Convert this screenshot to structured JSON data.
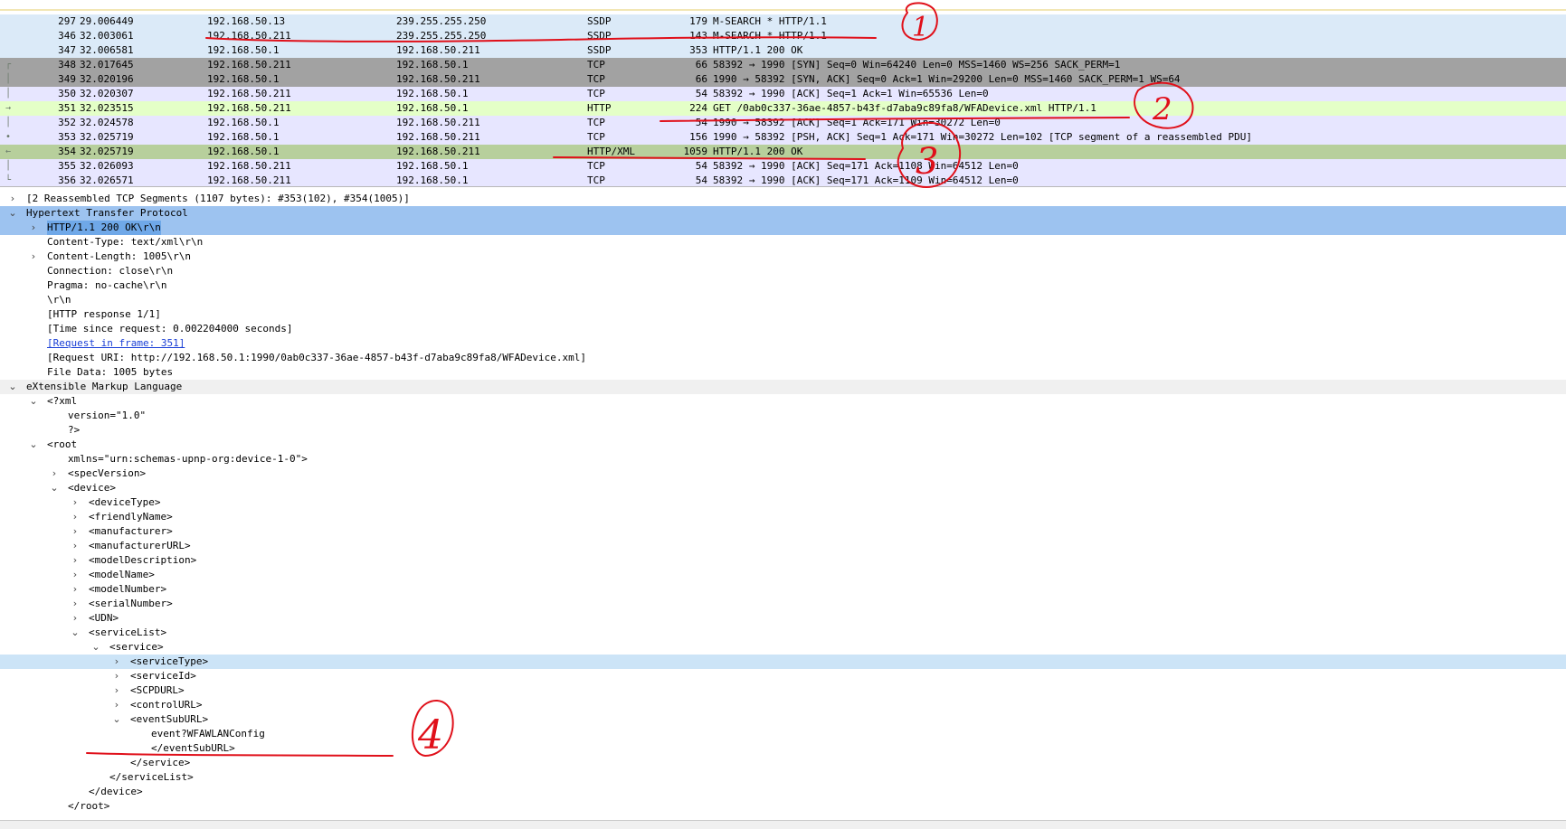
{
  "packet_list": {
    "rows": [
      {
        "no": "297",
        "time": "29.006449",
        "source": "192.168.50.13",
        "destination": "239.255.255.250",
        "protocol": "SSDP",
        "length": "179",
        "info": "M-SEARCH * HTTP/1.1",
        "bg": "#dbeaf8",
        "mark": ""
      },
      {
        "no": "346",
        "time": "32.003061",
        "source": "192.168.50.211",
        "destination": "239.255.255.250",
        "protocol": "SSDP",
        "length": "143",
        "info": "M-SEARCH * HTTP/1.1",
        "bg": "#dbeaf8",
        "mark": ""
      },
      {
        "no": "347",
        "time": "32.006581",
        "source": "192.168.50.1",
        "destination": "192.168.50.211",
        "protocol": "SSDP",
        "length": "353",
        "info": "HTTP/1.1 200 OK",
        "bg": "#dbeaf8",
        "mark": ""
      },
      {
        "no": "348",
        "time": "32.017645",
        "source": "192.168.50.211",
        "destination": "192.168.50.1",
        "protocol": "TCP",
        "length": "66",
        "info": "58392 → 1990 [SYN] Seq=0 Win=64240 Len=0 MSS=1460 WS=256 SACK_PERM=1",
        "bg": "#a2a2a2",
        "mark": "┌"
      },
      {
        "no": "349",
        "time": "32.020196",
        "source": "192.168.50.1",
        "destination": "192.168.50.211",
        "protocol": "TCP",
        "length": "66",
        "info": "1990 → 58392 [SYN, ACK] Seq=0 Ack=1 Win=29200 Len=0 MSS=1460 SACK_PERM=1 WS=64",
        "bg": "#a2a2a2",
        "mark": "│"
      },
      {
        "no": "350",
        "time": "32.020307",
        "source": "192.168.50.211",
        "destination": "192.168.50.1",
        "protocol": "TCP",
        "length": "54",
        "info": "58392 → 1990 [ACK] Seq=1 Ack=1 Win=65536 Len=0",
        "bg": "#e7e6ff",
        "mark": "│"
      },
      {
        "no": "351",
        "time": "32.023515",
        "source": "192.168.50.211",
        "destination": "192.168.50.1",
        "protocol": "HTTP",
        "length": "224",
        "info": "GET /0ab0c337-36ae-4857-b43f-d7aba9c89fa8/WFADevice.xml HTTP/1.1",
        "bg": "#e4ffc7",
        "mark": "→"
      },
      {
        "no": "352",
        "time": "32.024578",
        "source": "192.168.50.1",
        "destination": "192.168.50.211",
        "protocol": "TCP",
        "length": "54",
        "info": "1990 → 58392 [ACK] Seq=1 Ack=171 Win=30272 Len=0",
        "bg": "#e7e6ff",
        "mark": "│"
      },
      {
        "no": "353",
        "time": "32.025719",
        "source": "192.168.50.1",
        "destination": "192.168.50.211",
        "protocol": "TCP",
        "length": "156",
        "info": "1990 → 58392 [PSH, ACK] Seq=1 Ack=171 Win=30272 Len=102 [TCP segment of a reassembled PDU]",
        "bg": "#e7e6ff",
        "mark": "•"
      },
      {
        "no": "354",
        "time": "32.025719",
        "source": "192.168.50.1",
        "destination": "192.168.50.211",
        "protocol": "HTTP/XML",
        "length": "1059",
        "info": "HTTP/1.1 200 OK",
        "bg": "#b7cf9c",
        "mark": "←"
      },
      {
        "no": "355",
        "time": "32.026093",
        "source": "192.168.50.211",
        "destination": "192.168.50.1",
        "protocol": "TCP",
        "length": "54",
        "info": "58392 → 1990 [ACK] Seq=171 Ack=1108 Win=64512 Len=0",
        "bg": "#e7e6ff",
        "mark": "│"
      },
      {
        "no": "356",
        "time": "32.026571",
        "source": "192.168.50.211",
        "destination": "192.168.50.1",
        "protocol": "TCP",
        "length": "54",
        "info": "58392 → 1990 [ACK] Seq=171 Ack=1109 Win=64512 Len=0",
        "bg": "#e7e6ff",
        "mark": "└"
      }
    ]
  },
  "details": {
    "lines": [
      {
        "arrow": "›",
        "indent": 0,
        "text": "[2 Reassembled TCP Segments (1107 bytes): #353(102), #354(1005)]",
        "style": ""
      },
      {
        "arrow": "⌄",
        "indent": 0,
        "text": "Hypertext Transfer Protocol",
        "style": "hdr"
      },
      {
        "arrow": "›",
        "indent": 1,
        "text": "HTTP/1.1 200 OK\\r\\n",
        "style": "inner"
      },
      {
        "arrow": "",
        "indent": 1,
        "text": "Content-Type: text/xml\\r\\n",
        "style": ""
      },
      {
        "arrow": "›",
        "indent": 1,
        "text": "Content-Length: 1005\\r\\n",
        "style": ""
      },
      {
        "arrow": "",
        "indent": 1,
        "text": "Connection: close\\r\\n",
        "style": ""
      },
      {
        "arrow": "",
        "indent": 1,
        "text": "Pragma: no-cache\\r\\n",
        "style": ""
      },
      {
        "arrow": "",
        "indent": 1,
        "text": "\\r\\n",
        "style": ""
      },
      {
        "arrow": "",
        "indent": 1,
        "text": "[HTTP response 1/1]",
        "style": ""
      },
      {
        "arrow": "",
        "indent": 1,
        "text": "[Time since request: 0.002204000 seconds]",
        "style": ""
      },
      {
        "arrow": "",
        "indent": 1,
        "text": "[Request in frame: 351]",
        "style": "link"
      },
      {
        "arrow": "",
        "indent": 1,
        "text": "[Request URI: http://192.168.50.1:1990/0ab0c337-36ae-4857-b43f-d7aba9c89fa8/WFADevice.xml]",
        "style": ""
      },
      {
        "arrow": "",
        "indent": 1,
        "text": "File Data: 1005 bytes",
        "style": ""
      },
      {
        "arrow": "⌄",
        "indent": 0,
        "text": "eXtensible Markup Language",
        "style": "section"
      },
      {
        "arrow": "⌄",
        "indent": 1,
        "text": "<?xml",
        "style": ""
      },
      {
        "arrow": "",
        "indent": 2,
        "text": "version=\"1.0\"",
        "style": ""
      },
      {
        "arrow": "",
        "indent": 2,
        "text": "?>",
        "style": ""
      },
      {
        "arrow": "⌄",
        "indent": 1,
        "text": "<root",
        "style": ""
      },
      {
        "arrow": "",
        "indent": 2,
        "text": "xmlns=\"urn:schemas-upnp-org:device-1-0\">",
        "style": ""
      },
      {
        "arrow": "›",
        "indent": 2,
        "text": "<specVersion>",
        "style": ""
      },
      {
        "arrow": "⌄",
        "indent": 2,
        "text": "<device>",
        "style": ""
      },
      {
        "arrow": "›",
        "indent": 3,
        "text": "<deviceType>",
        "style": ""
      },
      {
        "arrow": "›",
        "indent": 3,
        "text": "<friendlyName>",
        "style": ""
      },
      {
        "arrow": "›",
        "indent": 3,
        "text": "<manufacturer>",
        "style": ""
      },
      {
        "arrow": "›",
        "indent": 3,
        "text": "<manufacturerURL>",
        "style": ""
      },
      {
        "arrow": "›",
        "indent": 3,
        "text": "<modelDescription>",
        "style": ""
      },
      {
        "arrow": "›",
        "indent": 3,
        "text": "<modelName>",
        "style": ""
      },
      {
        "arrow": "›",
        "indent": 3,
        "text": "<modelNumber>",
        "style": ""
      },
      {
        "arrow": "›",
        "indent": 3,
        "text": "<serialNumber>",
        "style": ""
      },
      {
        "arrow": "›",
        "indent": 3,
        "text": "<UDN>",
        "style": ""
      },
      {
        "arrow": "⌄",
        "indent": 3,
        "text": "<serviceList>",
        "style": ""
      },
      {
        "arrow": "⌄",
        "indent": 4,
        "text": "<service>",
        "style": ""
      },
      {
        "arrow": "›",
        "indent": 5,
        "text": "<serviceType>",
        "style": "light"
      },
      {
        "arrow": "›",
        "indent": 5,
        "text": "<serviceId>",
        "style": ""
      },
      {
        "arrow": "›",
        "indent": 5,
        "text": "<SCPDURL>",
        "style": ""
      },
      {
        "arrow": "›",
        "indent": 5,
        "text": "<controlURL>",
        "style": ""
      },
      {
        "arrow": "⌄",
        "indent": 5,
        "text": "<eventSubURL>",
        "style": ""
      },
      {
        "arrow": "",
        "indent": 6,
        "text": "event?WFAWLANConfig",
        "style": ""
      },
      {
        "arrow": "",
        "indent": 6,
        "text": "</eventSubURL>",
        "style": ""
      },
      {
        "arrow": "",
        "indent": 5,
        "text": "</service>",
        "style": ""
      },
      {
        "arrow": "",
        "indent": 4,
        "text": "</serviceList>",
        "style": ""
      },
      {
        "arrow": "",
        "indent": 3,
        "text": "</device>",
        "style": ""
      },
      {
        "arrow": "",
        "indent": 2,
        "text": "</root>",
        "style": ""
      }
    ]
  },
  "annotations": {
    "color": "#e0101a",
    "labels": [
      "1",
      "2",
      "3",
      "4"
    ]
  }
}
